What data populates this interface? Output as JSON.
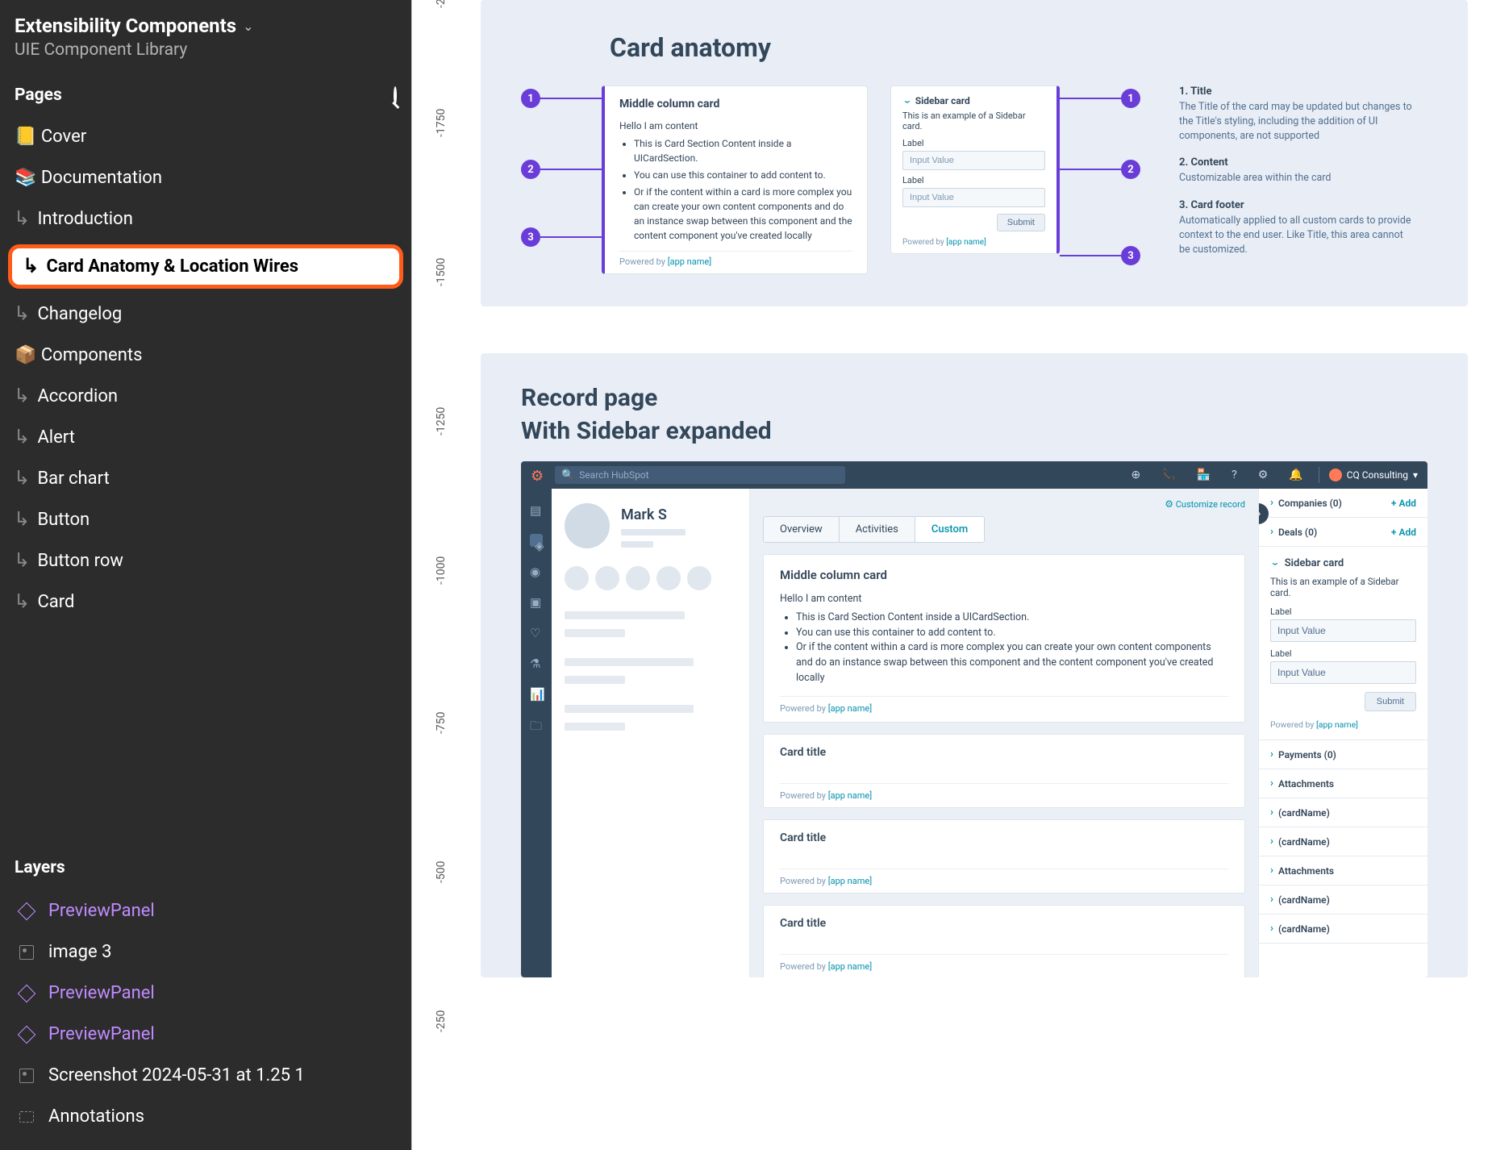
{
  "sidebar": {
    "title": "Extensibility Components",
    "subtitle": "UIE Component Library",
    "pages_heading": "Pages",
    "layers_heading": "Layers",
    "pages": [
      {
        "label": "📒 Cover",
        "indent": false
      },
      {
        "label": "📚 Documentation",
        "indent": false
      },
      {
        "label": "Introduction",
        "indent": true
      },
      {
        "label": "Card Anatomy & Location Wires",
        "indent": true,
        "selected": true
      },
      {
        "label": "Changelog",
        "indent": true
      },
      {
        "label": "📦 Components",
        "indent": false
      },
      {
        "label": "Accordion",
        "indent": true
      },
      {
        "label": "Alert",
        "indent": true
      },
      {
        "label": "Bar chart",
        "indent": true
      },
      {
        "label": "Button",
        "indent": true
      },
      {
        "label": "Button row",
        "indent": true
      },
      {
        "label": "Card",
        "indent": true
      }
    ],
    "layers": [
      {
        "label": "PreviewPanel",
        "type": "component",
        "purple": true
      },
      {
        "label": "image 3",
        "type": "image"
      },
      {
        "label": "PreviewPanel",
        "type": "component",
        "purple": true
      },
      {
        "label": "PreviewPanel",
        "type": "component",
        "purple": true
      },
      {
        "label": "Screenshot 2024-05-31 at 1.25 1",
        "type": "image"
      },
      {
        "label": "Annotations",
        "type": "frame"
      }
    ]
  },
  "ruler_ticks": [
    "-2",
    "-1750",
    "-1500",
    "-1250",
    "-1000",
    "-750",
    "-500",
    "-250"
  ],
  "anatomy": {
    "title": "Card anatomy",
    "middle_card": {
      "title": "Middle column card",
      "intro": "Hello I am content",
      "bullets": [
        "This is Card Section Content inside a UICardSection.",
        "You can use this container to add content to.",
        "Or if the content within a card is more complex you can create your own content components and do an instance swap between this component and the content component you've created locally"
      ],
      "powered_by": "Powered by",
      "app_name": "[app name]"
    },
    "sidebar_card": {
      "title": "Sidebar card",
      "desc": "This is an example of a Sidebar card.",
      "label": "Label",
      "input_value": "Input Value",
      "submit": "Submit",
      "powered_by": "Powered by",
      "app_name": "[app name]"
    },
    "legend": [
      {
        "head": "1. Title",
        "body": "The Title of the card may be updated but changes to the Title's styling, including the addition of UI components, are not supported"
      },
      {
        "head": "2. Content",
        "body": "Customizable area within the card"
      },
      {
        "head": "3. Card footer",
        "body": "Automatically applied to all custom cards to provide context to the end user. Like Title, this area cannot be customized."
      }
    ]
  },
  "record": {
    "title": "Record page",
    "subtitle": "With Sidebar expanded",
    "search_placeholder": "Search HubSpot",
    "account": "CQ Consulting",
    "customize": "Customize record",
    "person_name": "Mark S",
    "tabs": [
      "Overview",
      "Activities",
      "Custom"
    ],
    "active_tab": "Custom",
    "main_card": {
      "title": "Middle column card",
      "intro": "Hello I am content",
      "bullets": [
        "This is Card Section Content inside a UICardSection.",
        "You can use this container to add content to.",
        "Or if the content within a card is more complex you can create your own content components and do an instance swap between this component and the content component you've created locally"
      ],
      "powered_by": "Powered by",
      "app_name": "[app name]"
    },
    "slim_cards": [
      {
        "title": "Card title",
        "app_name": "[app name]"
      },
      {
        "title": "Card title",
        "app_name": "[app name]"
      },
      {
        "title": "Card title",
        "app_name": "[app name]"
      }
    ],
    "right_rows_top": [
      {
        "label": "Companies (0)",
        "add": "+ Add"
      },
      {
        "label": "Deals (0)",
        "add": "+ Add"
      }
    ],
    "right_sidebar_card": {
      "title": "Sidebar card",
      "desc": "This is an example of a Sidebar card.",
      "label": "Label",
      "input_value": "Input Value",
      "submit": "Submit",
      "powered_by": "Powered by",
      "app_name": "[app name]"
    },
    "right_rows_bottom": [
      {
        "label": "Payments (0)"
      },
      {
        "label": "Attachments"
      },
      {
        "label": "(cardName)"
      },
      {
        "label": "(cardName)"
      },
      {
        "label": "Attachments"
      },
      {
        "label": "(cardName)"
      },
      {
        "label": "(cardName)"
      }
    ]
  }
}
